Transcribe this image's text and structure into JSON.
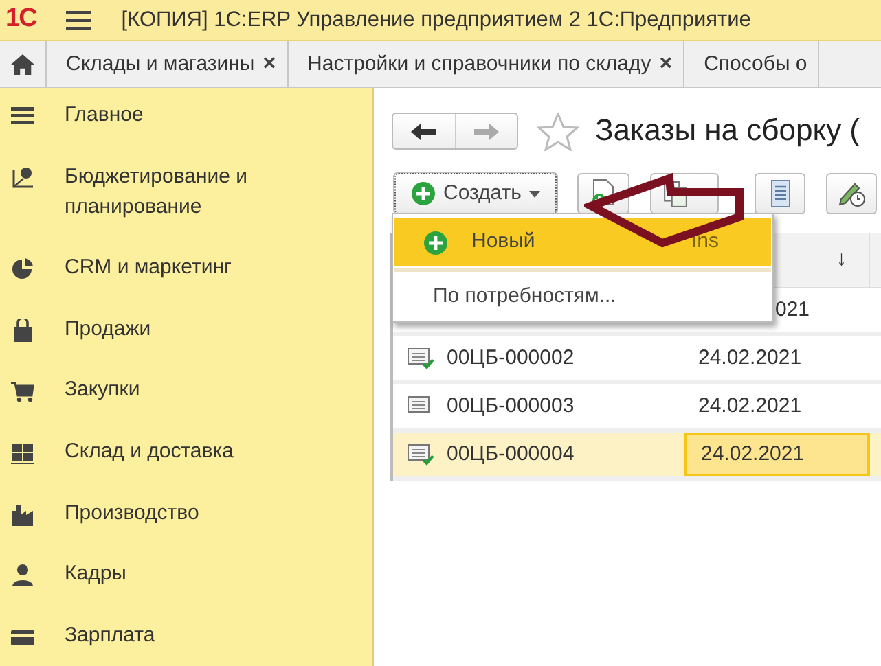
{
  "window": {
    "logo": "1С",
    "title": "[КОПИЯ] 1С:ERP Управление предприятием 2 1С:Предприятие"
  },
  "tabs": [
    {
      "label": "Склады и магазины",
      "close": "×"
    },
    {
      "label": "Настройки и справочники по складу",
      "close": "×"
    },
    {
      "label": "Способы о"
    }
  ],
  "sidebar": {
    "items": [
      "Главное",
      "Бюджетирование и планирование",
      "CRM и маркетинг",
      "Продажи",
      "Закупки",
      "Склад и доставка",
      "Производство",
      "Кадры",
      "Зарплата"
    ]
  },
  "form": {
    "title": "Заказы на сборку (",
    "create_button": "Создать",
    "menu": [
      {
        "kind": "add",
        "label": "Новый",
        "shortcut": "Ins",
        "selected": true
      },
      {
        "kind": "plain",
        "label": "По потребностям...",
        "selected": false
      }
    ],
    "table": {
      "sort_indicator": "↓",
      "rows": [
        {
          "date": "021",
          "selected": false
        },
        {
          "number": "00ЦБ-000002",
          "date": "24.02.2021",
          "posted": true,
          "selected": false
        },
        {
          "number": "00ЦБ-000003",
          "date": "24.02.2021",
          "posted": false,
          "selected": false
        },
        {
          "number": "00ЦБ-000004",
          "date": "24.02.2021",
          "posted": true,
          "selected": true
        }
      ]
    }
  }
}
